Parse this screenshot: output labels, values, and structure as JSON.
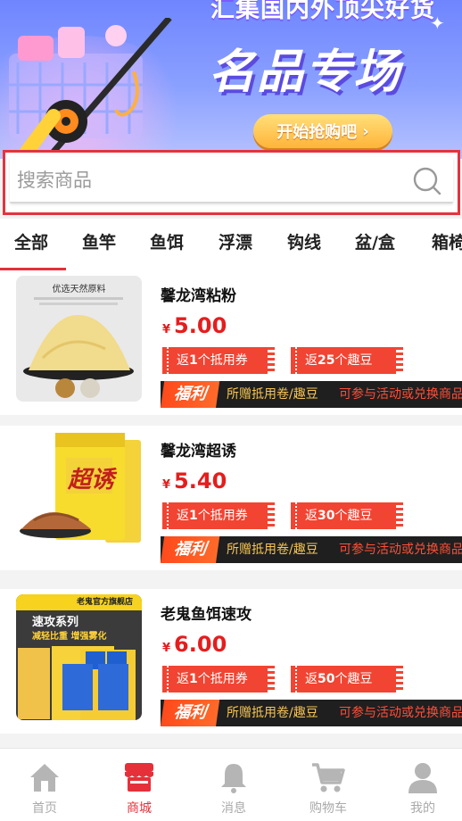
{
  "banner": {
    "headline": "汇集国内外顶尖好货",
    "title": "名品专场",
    "cta_label": "开始抢购吧"
  },
  "search": {
    "placeholder": "搜索商品"
  },
  "categories": [
    "全部",
    "鱼竿",
    "鱼饵",
    "浮漂",
    "钩线",
    "盆/盒",
    "箱椅"
  ],
  "active_category": "全部",
  "products": [
    {
      "name": "馨龙湾粘粉",
      "currency": "¥",
      "price": "5.00",
      "coupon1_prefix": "返",
      "coupon1_num": "1",
      "coupon1_suffix": "个抵用券",
      "coupon2_prefix": "返",
      "coupon2_num": "25",
      "coupon2_suffix": "个趣豆",
      "welfare_tag": "福利",
      "welfare_desc": "所赠抵用卷/趣豆",
      "welfare_note": "可参与活动或兑换商品",
      "thumb_caption": "优选天然原料"
    },
    {
      "name": "馨龙湾超诱",
      "currency": "¥",
      "price": "5.40",
      "coupon1_prefix": "返",
      "coupon1_num": "1",
      "coupon1_suffix": "个抵用券",
      "coupon2_prefix": "返",
      "coupon2_num": "30",
      "coupon2_suffix": "个趣豆",
      "welfare_tag": "福利",
      "welfare_desc": "所赠抵用卷/趣豆",
      "welfare_note": "可参与活动或兑换商品",
      "thumb_caption": "超诱"
    },
    {
      "name": "老鬼鱼饵速攻",
      "currency": "¥",
      "price": "6.00",
      "coupon1_prefix": "返",
      "coupon1_num": "1",
      "coupon1_suffix": "个抵用券",
      "coupon2_prefix": "返",
      "coupon2_num": "50",
      "coupon2_suffix": "个趣豆",
      "welfare_tag": "福利",
      "welfare_desc": "所赠抵用卷/趣豆",
      "welfare_note": "可参与活动或兑换商品",
      "thumb_caption": "速攻系列",
      "thumb_sub": "减轻比重 增强雾化",
      "thumb_store": "老鬼官方旗舰店"
    }
  ],
  "tabbar": {
    "items": [
      {
        "label": "首页",
        "icon": "home-icon"
      },
      {
        "label": "商城",
        "icon": "shop-icon"
      },
      {
        "label": "消息",
        "icon": "bell-icon"
      },
      {
        "label": "购物车",
        "icon": "cart-icon"
      },
      {
        "label": "我的",
        "icon": "user-icon"
      }
    ],
    "active": "商城"
  },
  "colors": {
    "accent": "#e5303a",
    "price": "#e51d1d",
    "coupon": "#f24432",
    "welfare_bg": "#1f1f1f",
    "welfare_text": "#f6c453"
  }
}
